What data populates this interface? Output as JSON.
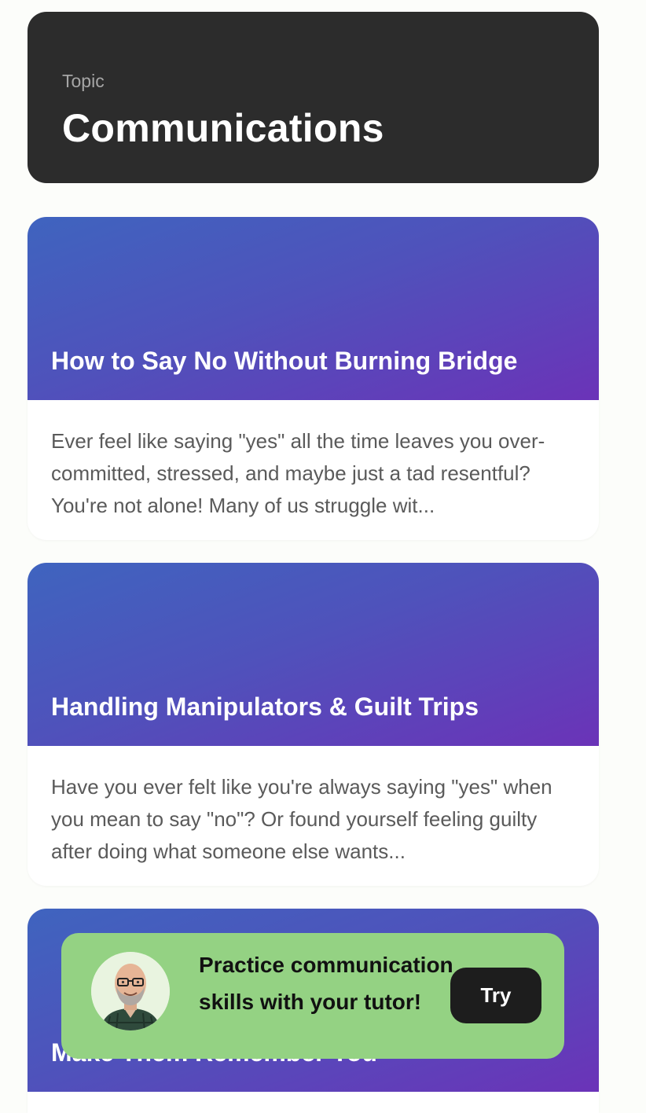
{
  "header": {
    "label": "Topic",
    "title": "Communications"
  },
  "articles": [
    {
      "title": "How to Say No Without Burning Bridge",
      "excerpt": "Ever feel like saying \"yes\" all the time leaves you over-committed, stressed, and maybe just a tad resentful? You're not alone! Many of us struggle wit..."
    },
    {
      "title": "Handling Manipulators & Guilt Trips",
      "excerpt": "Have you ever felt like you're always saying \"yes\" when you mean to say \"no\"? Or found yourself feeling guilty after doing what someone else wants..."
    },
    {
      "title": "Make Them Remember You",
      "excerpt": ""
    }
  ],
  "promo": {
    "text": "Practice communication skills with your tutor!",
    "button_label": "Try",
    "avatar_icon": "tutor-avatar",
    "background": "#94d283"
  },
  "colors": {
    "header_bg": "#2c2c2c",
    "banner_gradient": [
      "#3f64bf",
      "#4f52bb",
      "#6b33b8"
    ],
    "button_bg": "#1d1d1d"
  }
}
